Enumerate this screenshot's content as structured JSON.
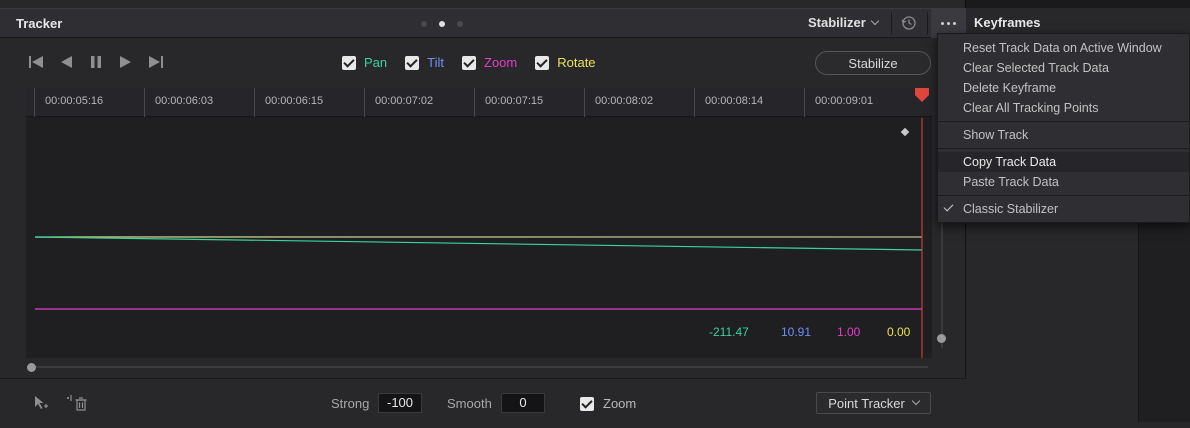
{
  "tracker": {
    "title": "Tracker",
    "mode": "Stabilizer",
    "stabilize_label": "Stabilize"
  },
  "channels": [
    {
      "label": "Pan",
      "color": "#3ad29f"
    },
    {
      "label": "Tilt",
      "color": "#6f8ff7"
    },
    {
      "label": "Zoom",
      "color": "#e23fc8"
    },
    {
      "label": "Rotate",
      "color": "#e8e15a"
    }
  ],
  "ruler": {
    "ticks": [
      "00:00:05:16",
      "00:00:06:03",
      "00:00:06:15",
      "00:00:07:02",
      "00:00:07:15",
      "00:00:08:02",
      "00:00:08:14",
      "00:00:09:01"
    ]
  },
  "readouts": {
    "pan": "-211.47",
    "tilt": "10.91",
    "zoom": "1.00",
    "rotate": "0.00"
  },
  "bottom": {
    "strong_label": "Strong",
    "strong_value": "-100",
    "smooth_label": "Smooth",
    "smooth_value": "0",
    "zoom_label": "Zoom",
    "tracker_type": "Point Tracker"
  },
  "keyframes": {
    "title": "Keyframes"
  },
  "menu": {
    "items": [
      "Reset Track Data on Active Window",
      "Clear Selected Track Data",
      "Delete Keyframe",
      "Clear All Tracking Points",
      "Show Track",
      "Copy Track Data",
      "Paste Track Data",
      "Classic Stabilizer"
    ]
  },
  "colors": {
    "playhead": "#e0463c",
    "accent_pan": "#3ad29f",
    "accent_tilt": "#6f8ff7",
    "accent_zoom": "#e23fc8",
    "accent_rotate": "#e8e15a"
  }
}
